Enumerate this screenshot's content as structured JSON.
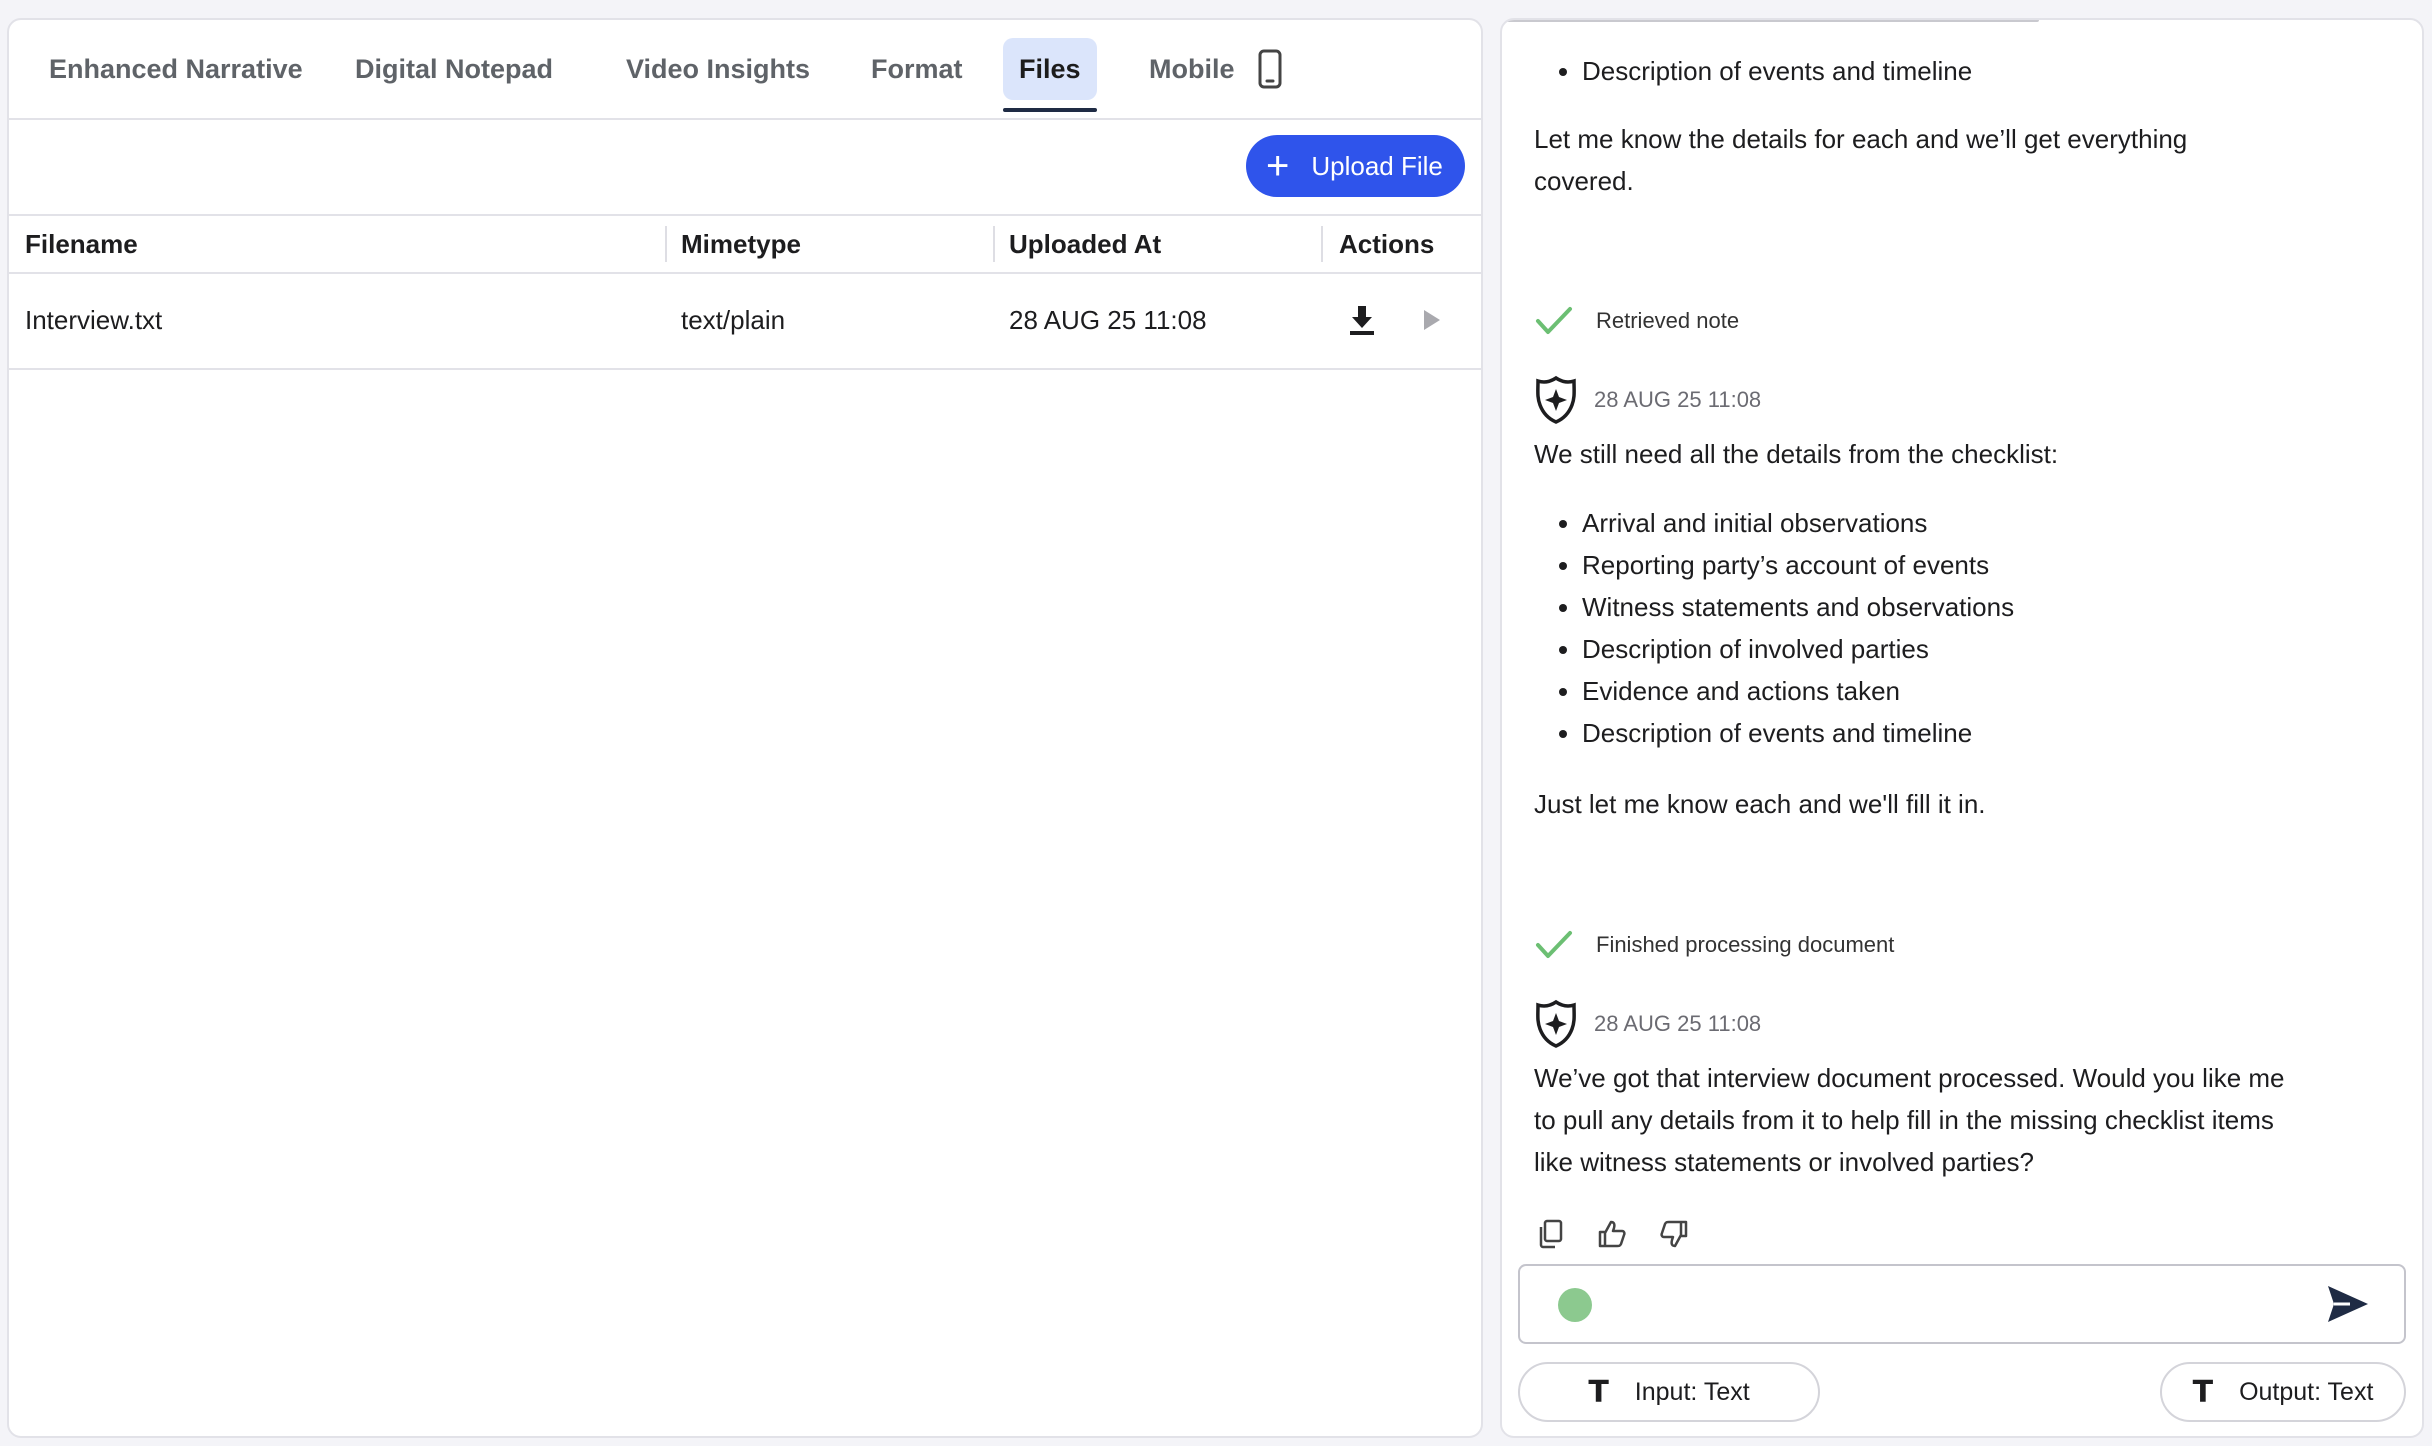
{
  "tabs": [
    {
      "label": "Enhanced Narrative",
      "active": false
    },
    {
      "label": "Digital Notepad",
      "active": false
    },
    {
      "label": "Video Insights",
      "active": false
    },
    {
      "label": "Format",
      "active": false
    },
    {
      "label": "Files",
      "active": true
    },
    {
      "label": "Mobile",
      "active": false,
      "icon": "mobile-phone-icon"
    }
  ],
  "toolbar": {
    "upload_label": "Upload File",
    "upload_icon": "plus-icon"
  },
  "table": {
    "columns": [
      "Filename",
      "Mimetype",
      "Uploaded At",
      "Actions"
    ],
    "rows": [
      {
        "filename": "Interview.txt",
        "mimetype": "text/plain",
        "uploaded_at": "28 AUG 25 11:08",
        "actions": [
          "download-icon",
          "play-icon"
        ]
      }
    ]
  },
  "chat": {
    "top_bullet": "Description of events and timeline",
    "intro_text": "Let me know the details for each and we’ll get everything covered.",
    "status_1": "Retrieved note",
    "message_1": {
      "timestamp": "28 AUG 25 11:08",
      "text": "We still need all the details from the checklist:",
      "bullets": [
        "Arrival and initial observations",
        "Reporting party’s account of events",
        "Witness statements and observations",
        "Description of involved parties",
        "Evidence and actions taken",
        "Description of events and timeline"
      ],
      "closing": "Just let me know each and we'll fill it in."
    },
    "status_2": "Finished processing document",
    "message_2": {
      "timestamp": "28 AUG 25 11:08",
      "text": "We’ve got that interview document processed. Would you like me to pull any details from it to help fill in the missing checklist items like witness statements or involved parties?"
    },
    "feedback_icons": [
      "copy-icon",
      "thumbs-up-icon",
      "thumbs-down-icon"
    ],
    "input_placeholder": "",
    "input_mode_label": "Input: Text",
    "output_mode_label": "Output: Text"
  },
  "colors": {
    "accent": "#2f54eb",
    "active_tab_bg": "#dbe5fb",
    "success_check": "#6cbf73",
    "mic_dot": "#8cc98f"
  }
}
